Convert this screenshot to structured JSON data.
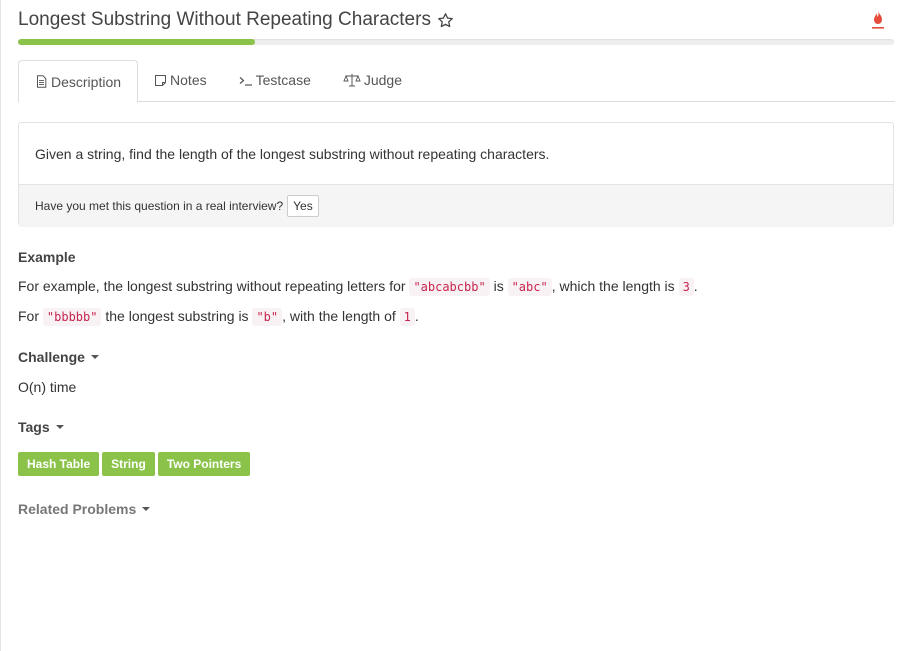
{
  "problem": {
    "title": "Longest Substring Without Repeating Characters",
    "progress_fraction": 0.27
  },
  "tabs": [
    {
      "label": "Description",
      "icon": "document-icon",
      "active": true
    },
    {
      "label": "Notes",
      "icon": "note-icon"
    },
    {
      "label": "Testcase",
      "icon": "terminal-icon"
    },
    {
      "label": "Judge",
      "icon": "scale-icon"
    }
  ],
  "description": {
    "text": "Given a string, find the length of the longest substring without repeating characters.",
    "interview_question": "Have you met this question in a real interview?",
    "yes_label": "Yes"
  },
  "example": {
    "heading": "Example",
    "line1": {
      "t1": "For example, the longest substring without repeating letters for ",
      "c1": "\"abcabcbb\"",
      "t2": " is ",
      "c2": "\"abc\"",
      "t3": ", which the length is ",
      "c3": "3",
      "t4": "."
    },
    "line2": {
      "t1": "For ",
      "c1": "\"bbbbb\"",
      "t2": " the longest substring is ",
      "c2": "\"b\"",
      "t3": ", with the length of ",
      "c3": "1",
      "t4": "."
    }
  },
  "challenge": {
    "heading": "Challenge",
    "text": "O(n) time"
  },
  "tags": {
    "heading": "Tags",
    "items": [
      "Hash Table",
      "String",
      "Two Pointers"
    ]
  },
  "related": {
    "heading": "Related Problems"
  },
  "colors": {
    "accent_green": "#8bc34a",
    "fire_red": "#e74c3c"
  }
}
